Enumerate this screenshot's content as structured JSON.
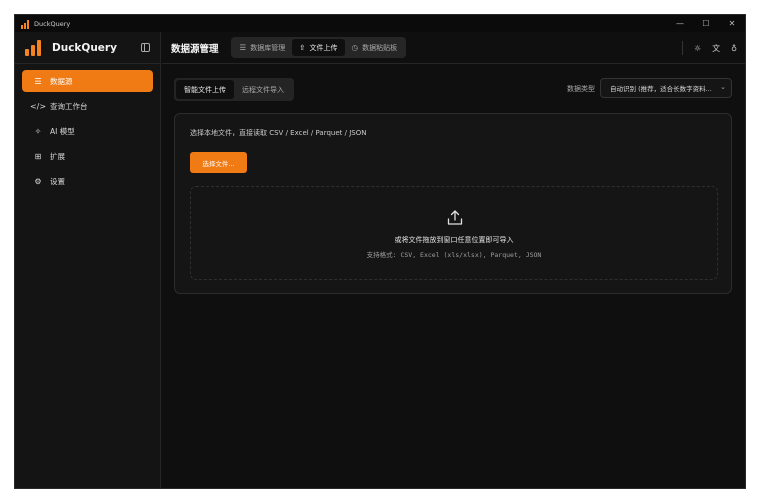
{
  "window": {
    "title": "DuckQuery",
    "controls": [
      "—",
      "☐",
      "✕"
    ]
  },
  "sidebar": {
    "brand": "DuckQuery",
    "items": [
      {
        "label": "数据源",
        "icon": "database-icon",
        "glyph": "☰"
      },
      {
        "label": "查询工作台",
        "icon": "code-icon",
        "glyph": "</>"
      },
      {
        "label": "AI 模型",
        "icon": "sparkle-icon",
        "glyph": "✧"
      },
      {
        "label": "扩展",
        "icon": "extensions-icon",
        "glyph": "⊞"
      },
      {
        "label": "设置",
        "icon": "gear-icon",
        "glyph": "⚙"
      }
    ]
  },
  "header": {
    "title": "数据源管理",
    "tabs": [
      {
        "label": "数据库管理",
        "icon": "database-icon",
        "glyph": "☰"
      },
      {
        "label": "文件上传",
        "icon": "upload-icon",
        "glyph": "⇧"
      },
      {
        "label": "数据粘贴板",
        "icon": "clipboard-icon",
        "glyph": "◷"
      }
    ],
    "actions": [
      {
        "icon": "theme-icon",
        "glyph": "☼"
      },
      {
        "icon": "translate-icon",
        "glyph": "文"
      },
      {
        "icon": "github-icon",
        "glyph": "♁"
      }
    ]
  },
  "upload": {
    "tabs": [
      "智能文件上传",
      "远程文件导入"
    ],
    "data_type_label": "数据类型",
    "data_type_value": "自动识别 (推荐，适合长数字资料...",
    "hint": "选择本地文件，直接读取 CSV / Excel / Parquet / JSON",
    "choose_button": "选择文件...",
    "drop_text": "或将文件拖放到窗口任意位置即可导入",
    "formats": "支持格式: CSV, Excel (xls/xlsx), Parquet, JSON"
  },
  "colors": {
    "accent": "#f07a14",
    "background": "#0f0f0f",
    "sidebar": "#141414"
  }
}
